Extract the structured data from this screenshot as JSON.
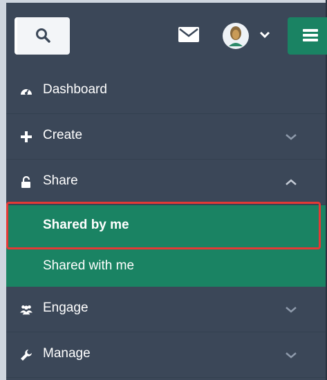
{
  "header": {
    "search_icon": "search-icon",
    "mail_icon": "envelope-icon",
    "avatar_icon": "user-avatar",
    "caret_icon": "chevron-down-icon",
    "menu_icon": "hamburger-menu-icon",
    "accent_color": "#1a8363"
  },
  "nav": {
    "items": [
      {
        "label": "Dashboard",
        "icon": "dashboard-gauge-icon"
      },
      {
        "label": "Create",
        "icon": "plus-icon",
        "chevron": "down"
      },
      {
        "label": "Share",
        "icon": "unlock-icon",
        "chevron": "up"
      },
      {
        "label": "Engage",
        "icon": "users-icon",
        "chevron": "down"
      },
      {
        "label": "Manage",
        "icon": "wrench-icon",
        "chevron": "down"
      }
    ],
    "share_sub": [
      {
        "label": "Shared by me",
        "active": true
      },
      {
        "label": "Shared with me",
        "active": false
      }
    ]
  }
}
